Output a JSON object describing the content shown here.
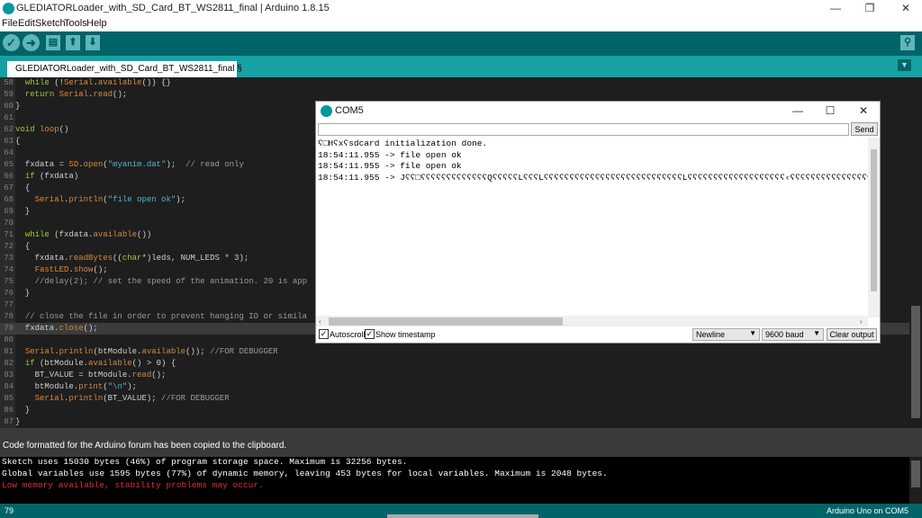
{
  "window": {
    "title": "GLEDIATORLoader_with_SD_Card_BT_WS2811_final | Arduino 1.8.15",
    "minimize": "—",
    "maximize": "❐",
    "close": "✕"
  },
  "menu": [
    "File",
    "Edit",
    "Sketch",
    "Tools",
    "Help"
  ],
  "toolbar": {
    "verify_icon": "check-icon",
    "upload_icon": "arrow-right-icon",
    "new_icon": "new-file-icon",
    "open_icon": "open-arrow-up-icon",
    "save_icon": "save-arrow-down-icon",
    "monitor_icon": "magnifier-icon",
    "verify_glyph": "✓",
    "upload_glyph": "➜",
    "new_glyph": "▤",
    "open_glyph": "⬆",
    "save_glyph": "⬇",
    "monitor_glyph": "⚲"
  },
  "tab": {
    "label": "GLEDIATORLoader_with_SD_Card_BT_WS2811_final §",
    "menu_glyph": "▼"
  },
  "code": [
    {
      "n": "58",
      "html": "  <span class=\"kw\">while</span> (!<span class=\"cls\">Serial</span>.<span class=\"fn\">available</span>()) {}"
    },
    {
      "n": "59",
      "html": "  <span class=\"kw\">return</span> <span class=\"cls\">Serial</span>.<span class=\"fn\">read</span>();"
    },
    {
      "n": "60",
      "html": "}"
    },
    {
      "n": "61",
      "html": ""
    },
    {
      "n": "62",
      "html": "<span class=\"kw\">void</span> <span class=\"fn\">loop</span>()"
    },
    {
      "n": "63",
      "html": "{"
    },
    {
      "n": "64",
      "html": ""
    },
    {
      "n": "65",
      "html": "  fxdata = <span class=\"cls\">SD</span>.<span class=\"fn\">open</span>(<span class=\"str\">\"myanim.dat\"</span>);  <span class=\"cm\">// read only</span>"
    },
    {
      "n": "66",
      "html": "  <span class=\"kw\">if</span> (fxdata)"
    },
    {
      "n": "67",
      "html": "  {"
    },
    {
      "n": "68",
      "html": "    <span class=\"cls\">Serial</span>.<span class=\"fn\">println</span>(<span class=\"str\">\"file open ok\"</span>);"
    },
    {
      "n": "69",
      "html": "  }"
    },
    {
      "n": "70",
      "html": ""
    },
    {
      "n": "71",
      "html": "  <span class=\"kw\">while</span> (fxdata.<span class=\"fn\">available</span>())"
    },
    {
      "n": "72",
      "html": "  {"
    },
    {
      "n": "73",
      "html": "    fxdata.<span class=\"fn\">readBytes</span>((<span class=\"kw\">char</span>*)leds, NUM_LEDS * 3);"
    },
    {
      "n": "74",
      "html": "    <span class=\"cls\">FastLED</span>.<span class=\"fn\">show</span>();"
    },
    {
      "n": "75",
      "html": "    <span class=\"cm\">//delay(2); // set the speed of the animation. 20 is app</span>"
    },
    {
      "n": "76",
      "html": "  }"
    },
    {
      "n": "77",
      "html": ""
    },
    {
      "n": "78",
      "html": "  <span class=\"cm\">// close the file in order to prevent hanging IO or simila</span>"
    },
    {
      "n": "79",
      "html": "  fxdata.<span class=\"fn\">close</span>();"
    },
    {
      "n": "80",
      "html": ""
    },
    {
      "n": "81",
      "html": "  <span class=\"cls\">Serial</span>.<span class=\"fn\">println</span>(btModule.<span class=\"fn\">available</span>()); <span class=\"cm\">//FOR DEBUGGER</span>"
    },
    {
      "n": "82",
      "html": "  <span class=\"kw\">if</span> (btModule.<span class=\"fn\">available</span>() &gt; 0) {"
    },
    {
      "n": "83",
      "html": "    BT_VALUE = btModule.<span class=\"fn\">read</span>();"
    },
    {
      "n": "84",
      "html": "    btModule.<span class=\"fn\">print</span>(<span class=\"str\">\"\\n\"</span>);"
    },
    {
      "n": "85",
      "html": "    <span class=\"cls\">Serial</span>.<span class=\"fn\">println</span>(BT_VALUE); <span class=\"cm\">//FOR DEBUGGER</span>"
    },
    {
      "n": "86",
      "html": "  }"
    },
    {
      "n": "87",
      "html": "}"
    }
  ],
  "highlight_line": "79",
  "message": "Code formatted for the Arduino forum has been copied to the clipboard.",
  "console": [
    "Sketch uses 15030 bytes (46%) of program storage space. Maximum is 32256 bytes.",
    "Global variables use 1595 bytes (77%) of dynamic memory, leaving 453 bytes for local variables. Maximum is 2048 bytes."
  ],
  "console_warning": "Low memory available, stability problems may occur.",
  "status": {
    "line": "79",
    "board": "Arduino Uno on COM5"
  },
  "serial_monitor": {
    "title": "COM5",
    "input_value": "",
    "send": "Send",
    "output": [
      "ʕ□Hʕxʕsdcard initialization done.",
      "18:54:11.955 -> file open ok",
      "18:54:11.955 -> file open ok",
      "18:54:11.955 -> Jʕʕ□ʕʕʕʕʕʕʕʕʕʕʕʕʕQʕʕʕʕʕLʕʕʕLʕʕʕʕʕʕʕʕʕʕʕʕʕʕʕʕʕʕʕʕʕʕʕʕʕʕʕLʕʕʕʕʕʕʕʕʕʕʕʕʕʕʕʕʕʕʕ‹ʕʕʕʕʕʕʕʕʕʕʕʕʕʕʕʕʕʕʕʕʕʕʕʕʕʕʕʕʕʕʕʕʕʕʕʕʕʕʕʕʕʕʕʕʕʕʕʕ"
    ],
    "autoscroll": "Autoscroll",
    "autoscroll_checked": true,
    "timestamp": "Show timestamp",
    "timestamp_checked": true,
    "line_ending": "Newline",
    "baud": "9600 baud",
    "clear": "Clear output"
  }
}
